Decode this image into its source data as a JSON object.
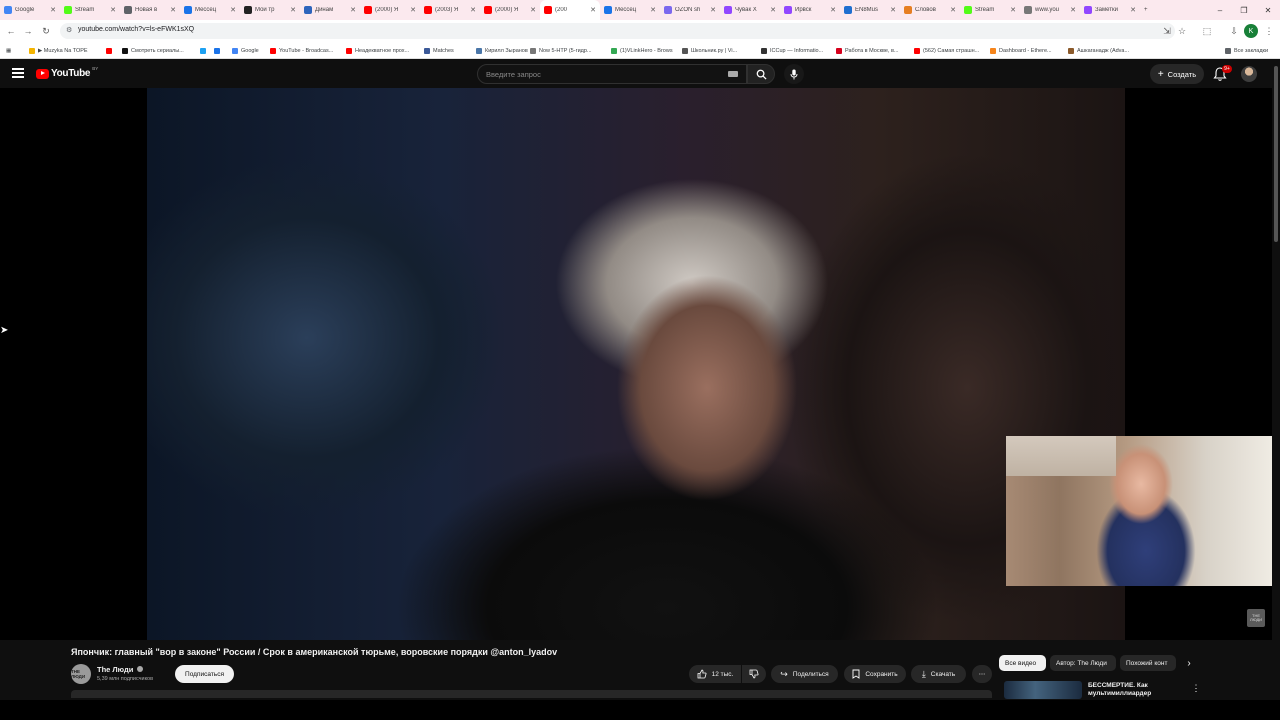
{
  "browser": {
    "tabs": [
      {
        "label": "Google",
        "favicon_color": "#4285f4",
        "active": false
      },
      {
        "label": "Stream",
        "favicon_color": "#53fc18",
        "active": false
      },
      {
        "label": "Новая в",
        "favicon_color": "#5f6368",
        "active": false
      },
      {
        "label": "Мессец",
        "favicon_color": "#1a73e8",
        "active": false
      },
      {
        "label": "Мои тр",
        "favicon_color": "#222222",
        "active": false
      },
      {
        "label": "Динам",
        "favicon_color": "#2d64bc",
        "active": false
      },
      {
        "label": "(2000) Я",
        "favicon_color": "#ff0000",
        "active": false
      },
      {
        "label": "(2003) Я",
        "favicon_color": "#ff0000",
        "active": false
      },
      {
        "label": "(2000) Я",
        "favicon_color": "#ff0000",
        "active": false
      },
      {
        "label": "(200",
        "favicon_color": "#ff0000",
        "active": true
      },
      {
        "label": "Мессец",
        "favicon_color": "#1a73e8",
        "active": false
      },
      {
        "label": "OZON sh",
        "favicon_color": "#7b68ee",
        "active": false
      },
      {
        "label": "Чувак Х",
        "favicon_color": "#9146ff",
        "active": false
      },
      {
        "label": "Ирвск",
        "favicon_color": "#9146ff",
        "active": false
      },
      {
        "label": "EN8Mus",
        "favicon_color": "#1f6fd0",
        "active": false
      },
      {
        "label": "Словов",
        "favicon_color": "#e67e22",
        "active": false
      },
      {
        "label": "Stream",
        "favicon_color": "#53fc18",
        "active": false
      },
      {
        "label": "www.you",
        "favicon_color": "#777777",
        "active": false
      },
      {
        "label": "Заметки",
        "favicon_color": "#9146ff",
        "active": false
      }
    ],
    "new_tab": "+",
    "window_controls": {
      "minimize": "–",
      "maximize": "❐",
      "close": "✕"
    },
    "url": "youtube.com/watch?v=ls-eFWK1sXQ",
    "profile_initial": "K",
    "bookmarks": [
      {
        "label": "▶ Muzyka Na TOPE",
        "color": "#f4b400"
      },
      {
        "label": "",
        "color": "#ff0000"
      },
      {
        "label": "Смотреть сериалы...",
        "color": "#111111"
      },
      {
        "label": "",
        "color": "#1da1f2"
      },
      {
        "label": "",
        "color": "#1a73e8"
      },
      {
        "label": "Google",
        "color": "#4285f4"
      },
      {
        "label": "YouTube - Broadcas...",
        "color": "#ff0000"
      },
      {
        "label": "Неадекватное прох...",
        "color": "#ff0000"
      },
      {
        "label": "Matches",
        "color": "#3b5998"
      },
      {
        "label": "Кирилл Зыранов",
        "color": "#4a76a8"
      },
      {
        "label": "Now 5-HTP (5-гидр...",
        "color": "#777777"
      },
      {
        "label": "(1)VLinkHero - Brows",
        "color": "#34a853"
      },
      {
        "label": "Школьник.ру | Vi...",
        "color": "#555555"
      },
      {
        "label": "ICCup — Informatio...",
        "color": "#333333"
      },
      {
        "label": "Работа в Москве, в...",
        "color": "#d6001c"
      },
      {
        "label": "(562) Самая страшн...",
        "color": "#ff0000"
      },
      {
        "label": "Dashboard - Ethere...",
        "color": "#f6851b"
      },
      {
        "label": "Ашкаганадж (Adva...",
        "color": "#8b5a2b"
      }
    ],
    "all_bookmarks": "Все закладки"
  },
  "youtube": {
    "logo_text": "YouTube",
    "logo_region": "BY",
    "search_placeholder": "Введите запрос",
    "create_label": "Создать",
    "notifications_count": "9+",
    "video": {
      "title": "Япончик: главный \"вор в законе\" России / Срок в американской тюрьме, воровские порядки @anton_lyadov",
      "channel_name": "The Люди",
      "channel_avatar_text": "THE ЛЮДИ",
      "subscribers": "5,39 млн подписчиков",
      "subscribe_label": "Подписаться",
      "likes": "12 тыс.",
      "share_label": "Поделиться",
      "save_label": "Сохранить",
      "download_label": "Скачать",
      "more": "⋯",
      "watermark": "THE ЛЮДИ"
    },
    "chips": [
      {
        "label": "Все видео",
        "active": true
      },
      {
        "label": "Автор: The Люди",
        "active": false
      },
      {
        "label": "Похожий конт",
        "active": false
      }
    ],
    "recommendation": {
      "title": "БЕССМЕРТИЕ. Как мультимиллиардер"
    }
  }
}
